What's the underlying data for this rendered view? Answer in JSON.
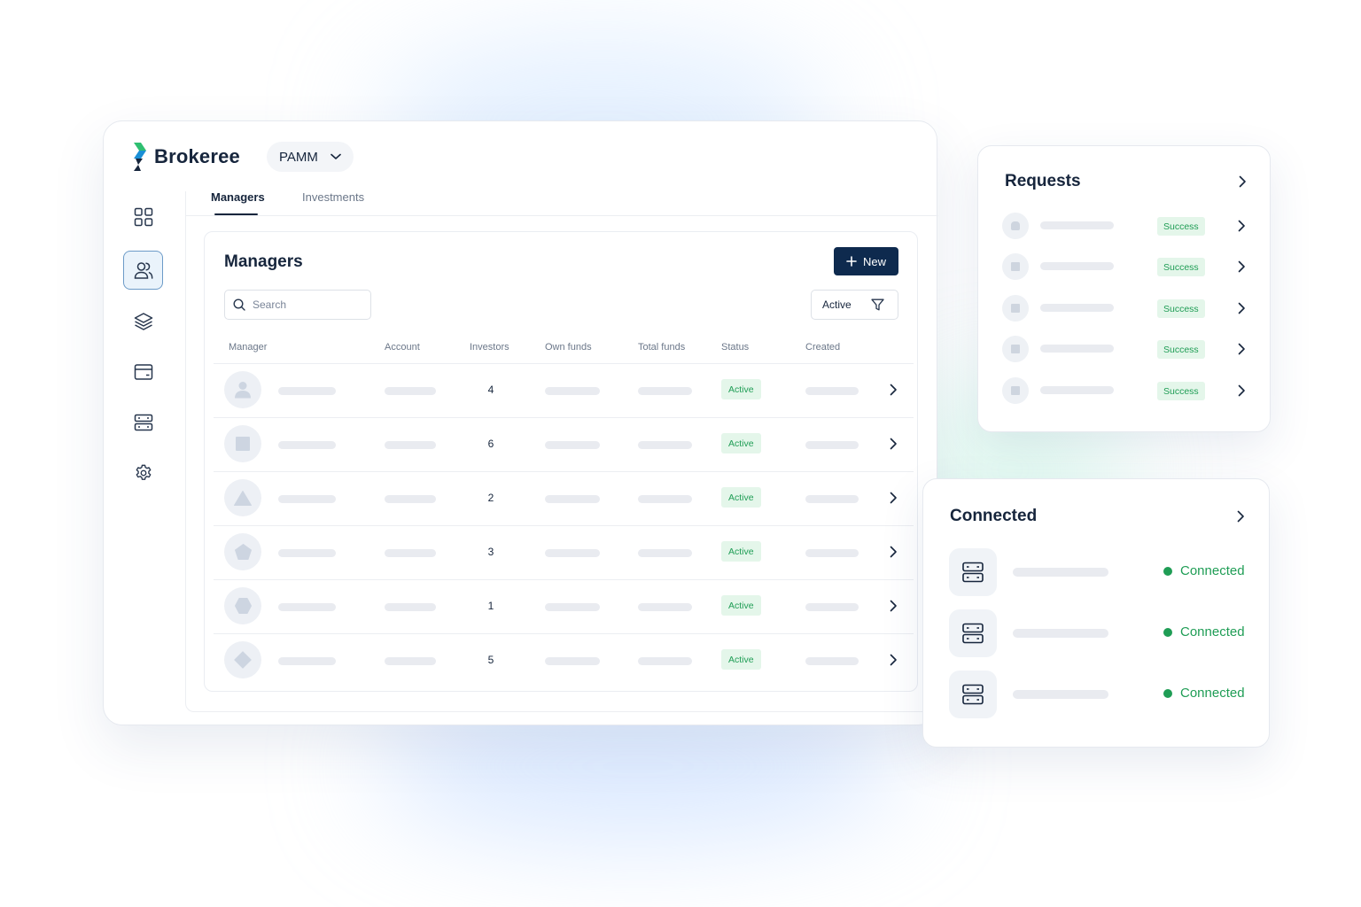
{
  "app": {
    "brand": "Brokeree",
    "product_selector": "PAMM"
  },
  "tabs": [
    {
      "label": "Managers",
      "active": true
    },
    {
      "label": "Investments",
      "active": false
    }
  ],
  "sidebar": {
    "items": [
      {
        "icon": "grid-icon",
        "active": false
      },
      {
        "icon": "users-icon",
        "active": true
      },
      {
        "icon": "layers-icon",
        "active": false
      },
      {
        "icon": "card-icon",
        "active": false
      },
      {
        "icon": "server-icon",
        "active": false
      },
      {
        "icon": "gear-icon",
        "active": false
      }
    ]
  },
  "managers": {
    "title": "Managers",
    "new_label": "New",
    "search_placeholder": "Search",
    "filter_label": "Active",
    "columns": [
      "Manager",
      "Account",
      "Investors",
      "Own funds",
      "Total funds",
      "Status",
      "Created"
    ],
    "rows": [
      {
        "avatar": "person",
        "investors": "4",
        "status": "Active"
      },
      {
        "avatar": "square",
        "investors": "6",
        "status": "Active"
      },
      {
        "avatar": "triangle",
        "investors": "2",
        "status": "Active"
      },
      {
        "avatar": "pentagon",
        "investors": "3",
        "status": "Active"
      },
      {
        "avatar": "hexagon",
        "investors": "1",
        "status": "Active"
      },
      {
        "avatar": "diamond",
        "investors": "5",
        "status": "Active"
      }
    ]
  },
  "requests": {
    "title": "Requests",
    "items": [
      {
        "status": "Success"
      },
      {
        "status": "Success"
      },
      {
        "status": "Success"
      },
      {
        "status": "Success"
      },
      {
        "status": "Success"
      }
    ]
  },
  "connected": {
    "title": "Connected",
    "items": [
      {
        "status": "Connected"
      },
      {
        "status": "Connected"
      },
      {
        "status": "Connected"
      }
    ]
  },
  "colors": {
    "primary": "#0e2a4e",
    "success": "#1f9d55",
    "success_bg": "#e4f6ea",
    "sidebar_active_border": "#6c9bc8",
    "brand_green": "#2fbf71"
  }
}
